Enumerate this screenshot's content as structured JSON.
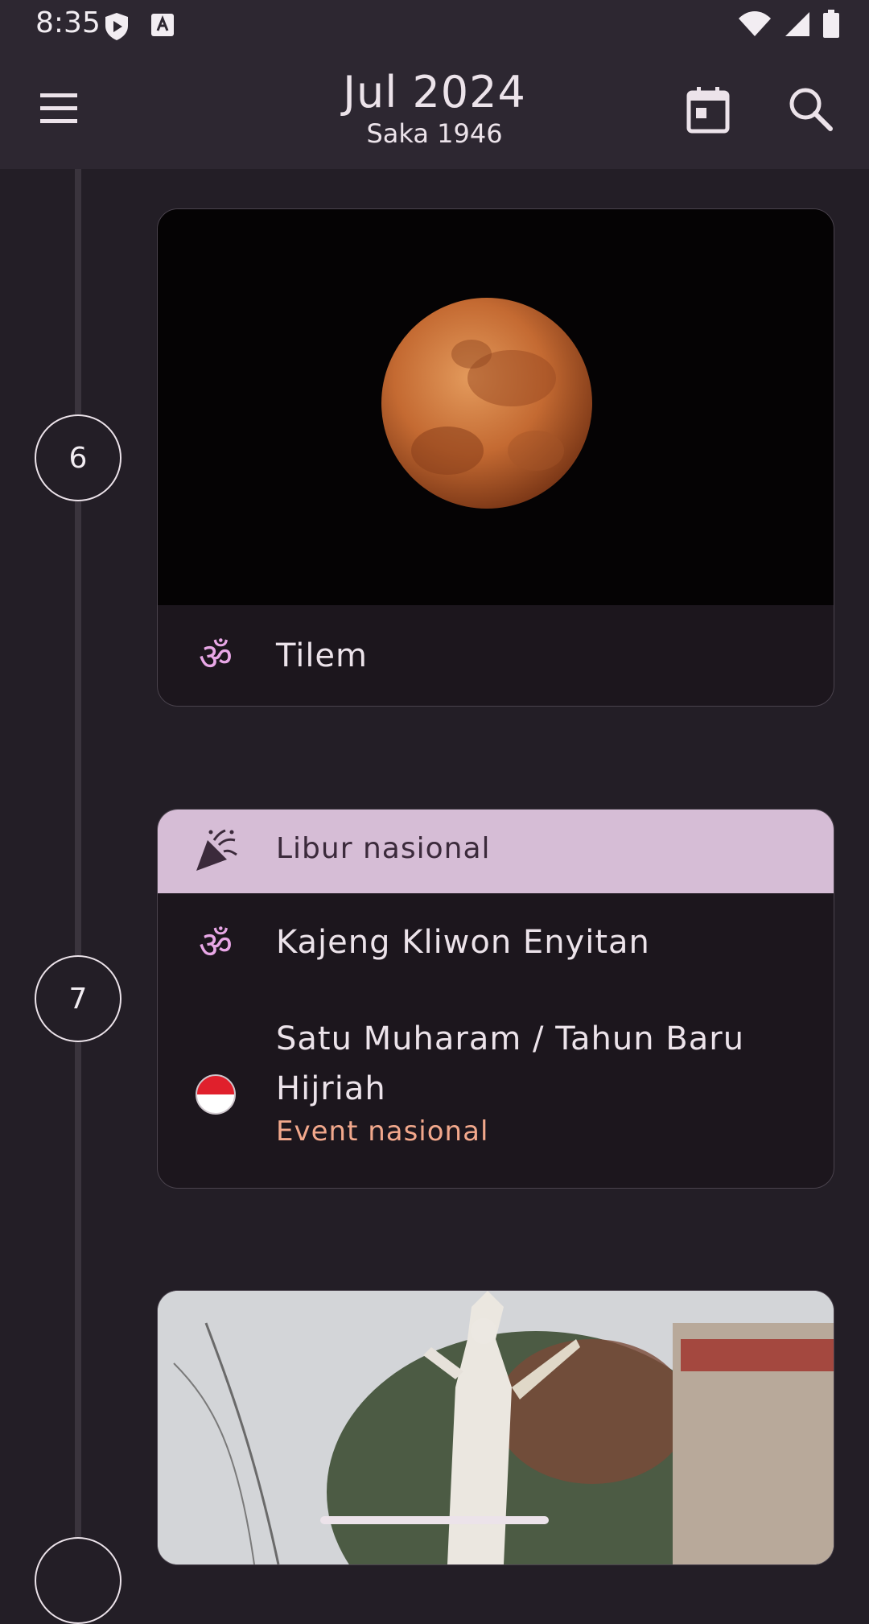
{
  "status_bar": {
    "time": "8:35"
  },
  "app_bar": {
    "title": "Jul 2024",
    "subtitle": "Saka 1946"
  },
  "days": [
    {
      "day": "6"
    },
    {
      "day": "7"
    }
  ],
  "cards": {
    "tilem": {
      "label": "Tilem"
    },
    "july7": {
      "holiday_label": "Libur nasional",
      "event1": "Kajeng Kliwon Enyitan",
      "event2_line1": "Satu Muharam / Tahun Baru",
      "event2_line2": "Hijriah",
      "event2_sub": "Event nasional"
    }
  },
  "colors": {
    "accent": "#d6bdd6",
    "event_sub": "#f2a88c",
    "om_icon": "#e8a7e6"
  }
}
